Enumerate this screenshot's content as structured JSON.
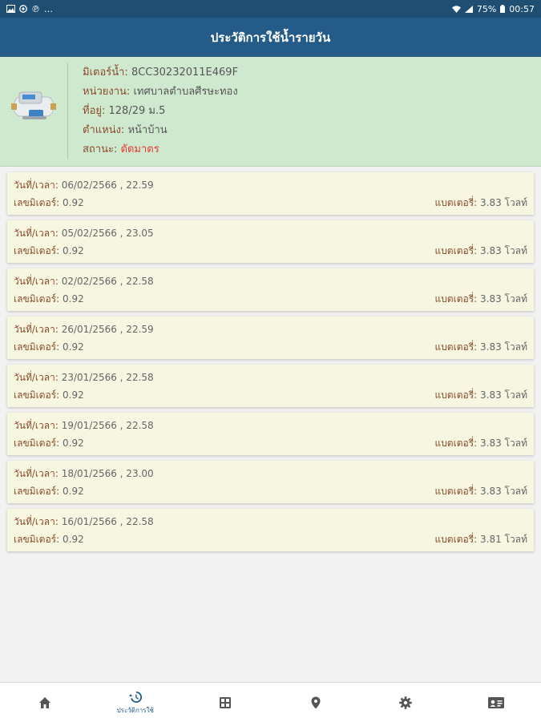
{
  "status_bar": {
    "left_icons": [
      "image-icon",
      "whatsapp-icon",
      "parking-icon",
      "more-dots-icon"
    ],
    "battery": "75%",
    "time": "00:57"
  },
  "header": {
    "title": "ประวัติการใช้น้ำรายวัน"
  },
  "meter": {
    "meter_id_label": "มิเตอร์น้ำ:",
    "meter_id": "8CC30232011E469F",
    "agency_label": "หน่วยงาน:",
    "agency": "เทศบาลตำบลศีรษะทอง",
    "address_label": "ที่อยู่:",
    "address": "128/29 ม.5",
    "position_label": "ตำแหน่ง:",
    "position": "หน้าบ้าน",
    "status_label": "สถานะ:",
    "status": "ตัดมาตร",
    "status_color": "#e53935"
  },
  "history": {
    "records": [
      {
        "date_label": "วันที่/เวลา:",
        "datetime": "06/02/2566 , 22.59",
        "reading_label": "เลขมิเตอร์:",
        "reading": "0.92",
        "battery_label": "แบตเตอรี่:",
        "battery": "3.83 โวลท์"
      },
      {
        "date_label": "วันที่/เวลา:",
        "datetime": "05/02/2566 , 23.05",
        "reading_label": "เลขมิเตอร์:",
        "reading": "0.92",
        "battery_label": "แบตเตอรี่:",
        "battery": "3.83 โวลท์"
      },
      {
        "date_label": "วันที่/เวลา:",
        "datetime": "02/02/2566 , 22.58",
        "reading_label": "เลขมิเตอร์:",
        "reading": "0.92",
        "battery_label": "แบตเตอรี่:",
        "battery": "3.83 โวลท์"
      },
      {
        "date_label": "วันที่/เวลา:",
        "datetime": "26/01/2566 , 22.59",
        "reading_label": "เลขมิเตอร์:",
        "reading": "0.92",
        "battery_label": "แบตเตอรี่:",
        "battery": "3.83 โวลท์"
      },
      {
        "date_label": "วันที่/เวลา:",
        "datetime": "23/01/2566 , 22.58",
        "reading_label": "เลขมิเตอร์:",
        "reading": "0.92",
        "battery_label": "แบตเตอรี่:",
        "battery": "3.83 โวลท์"
      },
      {
        "date_label": "วันที่/เวลา:",
        "datetime": "19/01/2566 , 22.58",
        "reading_label": "เลขมิเตอร์:",
        "reading": "0.92",
        "battery_label": "แบตเตอรี่:",
        "battery": "3.83 โวลท์"
      },
      {
        "date_label": "วันที่/เวลา:",
        "datetime": "18/01/2566 , 23.00",
        "reading_label": "เลขมิเตอร์:",
        "reading": "0.92",
        "battery_label": "แบตเตอรี่:",
        "battery": "3.83 โวลท์"
      },
      {
        "date_label": "วันที่/เวลา:",
        "datetime": "16/01/2566 , 22.58",
        "reading_label": "เลขมิเตอร์:",
        "reading": "0.92",
        "battery_label": "แบตเตอรี่:",
        "battery": "3.81 โวลท์"
      }
    ]
  },
  "bottom_nav": {
    "items": [
      {
        "icon": "home-icon",
        "label": "",
        "active": false
      },
      {
        "icon": "history-icon",
        "label": "ประวัติการใช้",
        "active": true
      },
      {
        "icon": "grid-icon",
        "label": "",
        "active": false
      },
      {
        "icon": "location-pin-icon",
        "label": "",
        "active": false
      },
      {
        "icon": "gear-icon",
        "label": "",
        "active": false
      },
      {
        "icon": "contact-card-icon",
        "label": "",
        "active": false
      }
    ]
  },
  "colors": {
    "app_bar": "#245b88",
    "status_bar": "#1f4e73",
    "meter_card_bg": "#cfe9cf",
    "record_card_bg": "#f6f6e1",
    "label_color": "#8b4a2b",
    "active_nav": "#245b88"
  }
}
